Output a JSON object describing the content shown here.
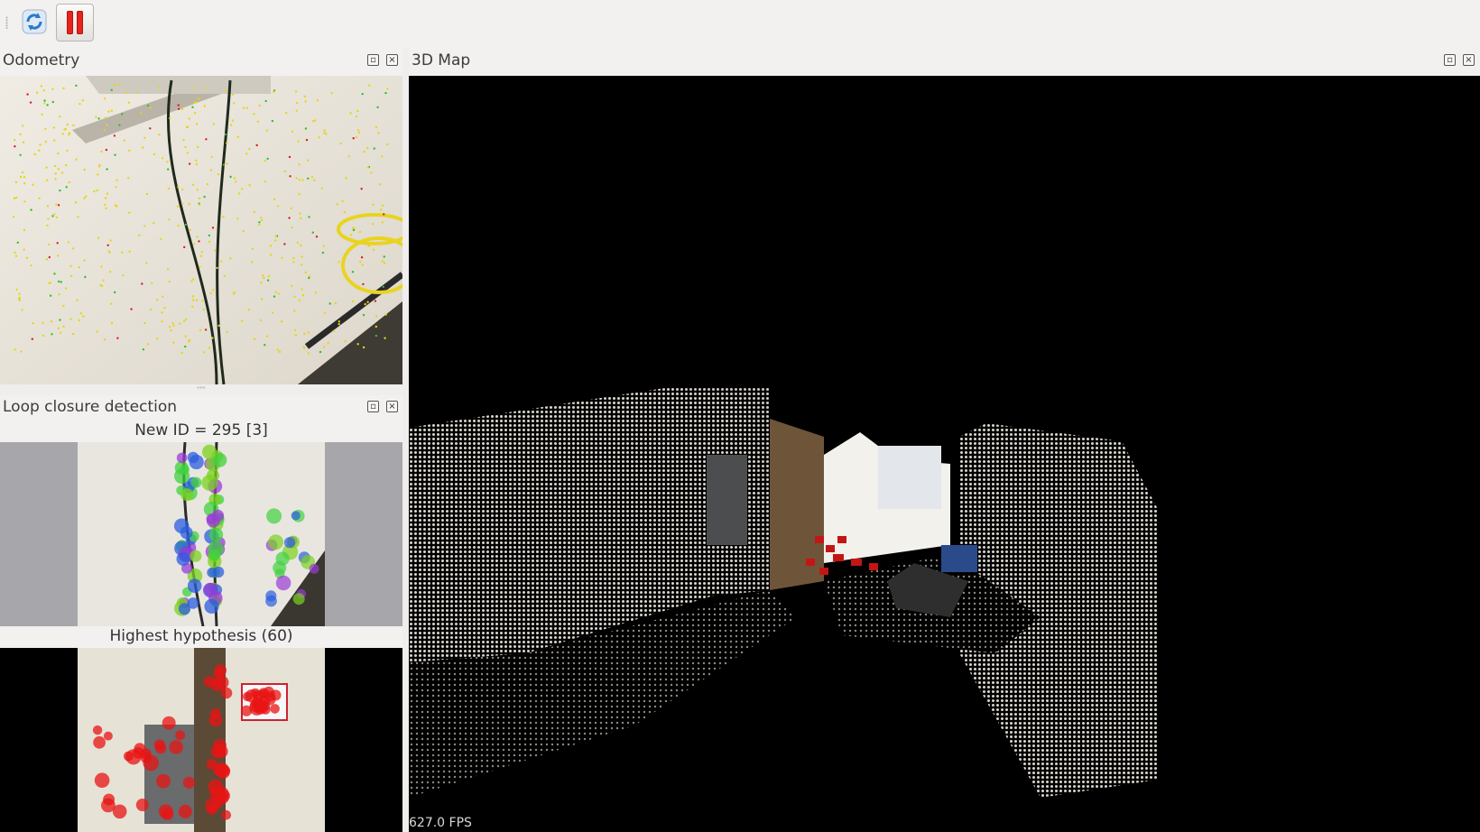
{
  "toolbar": {
    "refresh_icon": "refresh-icon",
    "pause_icon": "pause-icon",
    "accent_color": "#e8231c"
  },
  "panels": {
    "odometry": {
      "title": "Odometry"
    },
    "loop_closure": {
      "title": "Loop closure detection",
      "new_caption": "New ID = 295 [3]",
      "hypothesis_caption": "Highest hypothesis (60)"
    },
    "map": {
      "title": "3D Map",
      "fps": "627.0 FPS"
    }
  },
  "dock_buttons": {
    "float_icon": "float-icon",
    "close_icon": "close-icon"
  }
}
